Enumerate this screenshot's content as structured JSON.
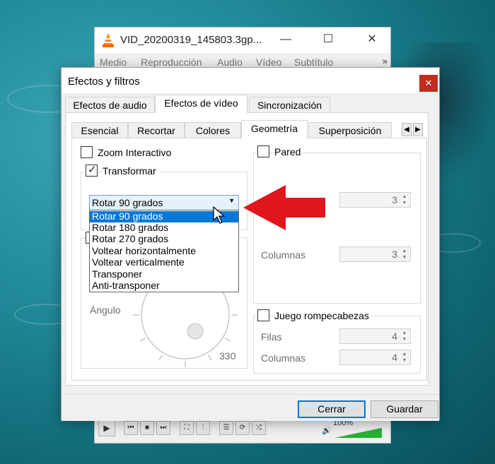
{
  "vlc": {
    "title": "VID_20200319_145803.3gp...",
    "menu": [
      "Medio",
      "Reproducción",
      "Audio",
      "Vídeo",
      "Subtítulo"
    ],
    "menu_more": "»",
    "volume_text": "100%",
    "volume_level": 1.0
  },
  "dialog": {
    "title": "Efectos y filtros",
    "close_glyph": "✕",
    "main_tabs": [
      "Efectos de audio",
      "Efectos de vídeo",
      "Sincronización"
    ],
    "active_main_tab": "Efectos de vídeo",
    "sub_tabs": [
      "Esencial",
      "Recortar",
      "Colores",
      "Geometría",
      "Superposición"
    ],
    "active_sub_tab": "Geometría",
    "zoom_label": "Zoom Interactivo",
    "zoom_checked": false,
    "transform_label": "Transformar",
    "transform_checked": true,
    "transform_selected": "Rotar 90 grados",
    "transform_options": [
      "Rotar 90 grados",
      "Rotar 180 grados",
      "Rotar 270 grados",
      "Voltear horizontalmente",
      "Voltear verticalmente",
      "Transponer",
      "Anti-transponer"
    ],
    "angle_label": "Ángulo",
    "angle_value": "330",
    "wall_label": "Pared",
    "wall_rows_value": "3",
    "wall_columns_label": "Columnas",
    "wall_columns_value": "3",
    "puzzle_label": "Juego rompecabezas",
    "puzzle_rows_label": "Filas",
    "puzzle_rows_value": "4",
    "puzzle_columns_label": "Columnas",
    "puzzle_columns_value": "4",
    "close_button": "Cerrar",
    "save_button": "Guardar"
  },
  "colors": {
    "accent": "#0078d7",
    "close_red": "#c42b1c",
    "annotation_arrow": "#e0161d"
  }
}
